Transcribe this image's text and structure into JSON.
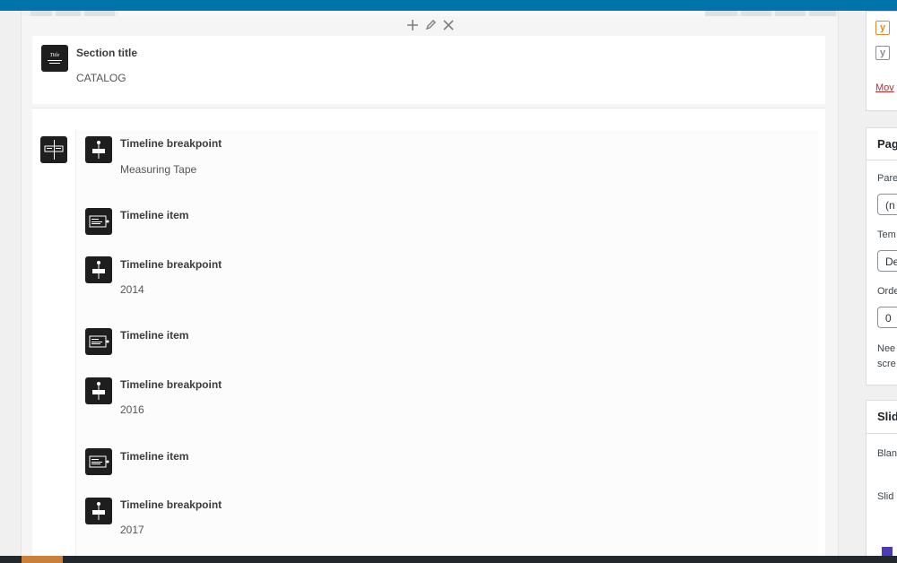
{
  "builder": {
    "section_element": {
      "title": "Section title",
      "subtitle": "CATALOG",
      "icon_text": "Title"
    },
    "timeline_items": [
      {
        "type": "breakpoint",
        "title": "Timeline breakpoint",
        "subtitle": "Measuring Tape"
      },
      {
        "type": "item",
        "title": "Timeline item",
        "subtitle": ""
      },
      {
        "type": "breakpoint",
        "title": "Timeline breakpoint",
        "subtitle": "2014"
      },
      {
        "type": "item",
        "title": "Timeline item",
        "subtitle": ""
      },
      {
        "type": "breakpoint",
        "title": "Timeline breakpoint",
        "subtitle": "2016"
      },
      {
        "type": "item",
        "title": "Timeline item",
        "subtitle": ""
      },
      {
        "type": "breakpoint",
        "title": "Timeline breakpoint",
        "subtitle": "2017"
      }
    ]
  },
  "sidebar": {
    "box1": {
      "link": "Mov"
    },
    "page_attributes": {
      "heading": "Pag",
      "parent_label": "Pare",
      "parent_value": "(n",
      "template_label": "Tem",
      "template_value": "De",
      "order_label": "Orde",
      "order_value": "0",
      "help_line1": "Nee",
      "help_line2": "scre"
    },
    "slider": {
      "heading": "Slid",
      "label1": "Blan",
      "label2": "Slid"
    }
  },
  "colors": {
    "topbar": "#0073aa",
    "icon_bg": "#1e1e1e",
    "link": "#b32d2e",
    "yoast_orange": "#e08a2b"
  }
}
